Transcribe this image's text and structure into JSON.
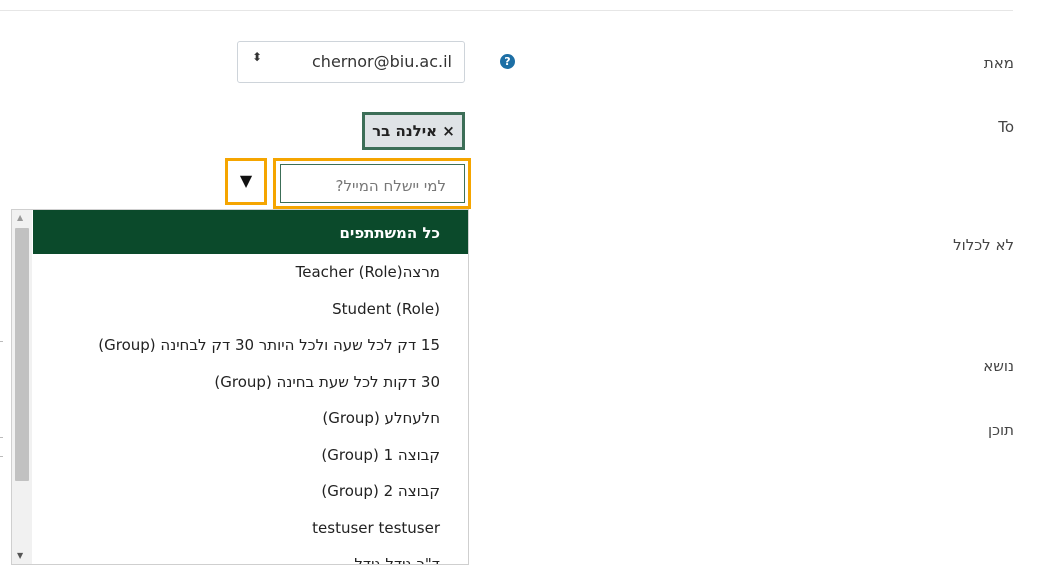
{
  "form": {
    "from_label": "מאת",
    "to_label": "To",
    "exclude_label": "לא לכלול",
    "subject_label": "נושא",
    "content_label": "תוכן",
    "from_value": "chernor@biu.ac.il",
    "selected_chip": "× אילנה בר",
    "to_placeholder": "למי יישלח המייל?",
    "help_icon_glyph": "?",
    "dropdown_button_glyph": "▼",
    "select_arrows_glyph": "⬍"
  },
  "dropdown": {
    "options": [
      "כל המשתתפים",
      "מרצה(Teacher (Role",
      "Student (Role)",
      "15 דק לכל שעה ולכל היותר 30 דק לבחינה (Group)",
      "30 דקות לכל שעת בחינה (Group)",
      "חלעחלע (Group)",
      "קבוצה 1 (Group)",
      "קבוצה 2 (Group)",
      "testuser testuser",
      "ד\"ר גידל גידל"
    ]
  },
  "colors": {
    "accent_focus": "#f5a500",
    "selected_option_bg": "#0b4a2b",
    "chip_border": "#3c6e57",
    "help_icon": "#1d6fa5"
  }
}
